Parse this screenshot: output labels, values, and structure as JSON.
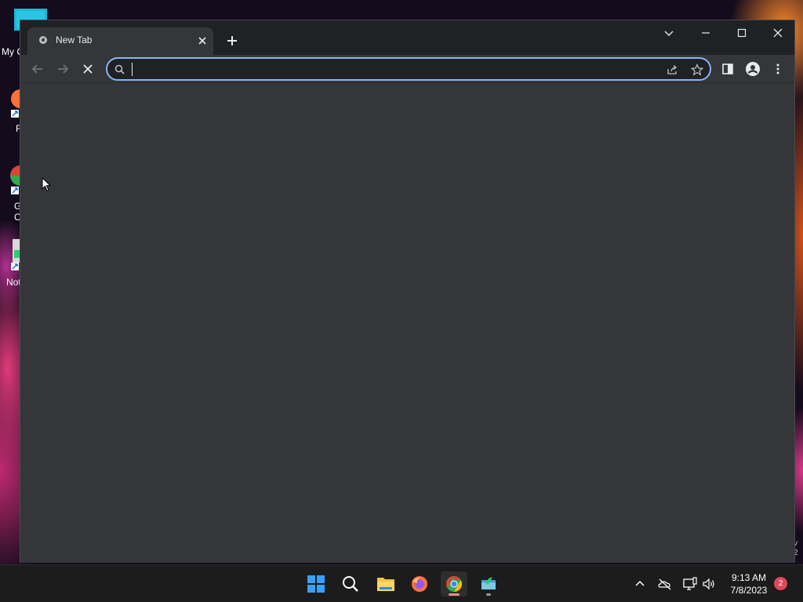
{
  "desktop": {
    "icons": [
      {
        "label": "My C"
      },
      {
        "label": "F"
      },
      {
        "label": "G\nC"
      },
      {
        "label": "Not"
      }
    ],
    "edge_text": "v\n2"
  },
  "browser": {
    "tab": {
      "title": "New Tab"
    },
    "omnibox": {
      "value": "",
      "placeholder": ""
    },
    "accent": "#8ab4f8",
    "background": "#35363a"
  },
  "taskbar": {
    "apps": [
      {
        "name": "start-icon"
      },
      {
        "name": "search-icon"
      },
      {
        "name": "file-explorer-icon"
      },
      {
        "name": "firefox-icon"
      },
      {
        "name": "chrome-icon"
      },
      {
        "name": "notepad-app-icon"
      }
    ],
    "clock": {
      "time": "9:13 AM",
      "date": "7/8/2023"
    },
    "notification_count": "2"
  }
}
